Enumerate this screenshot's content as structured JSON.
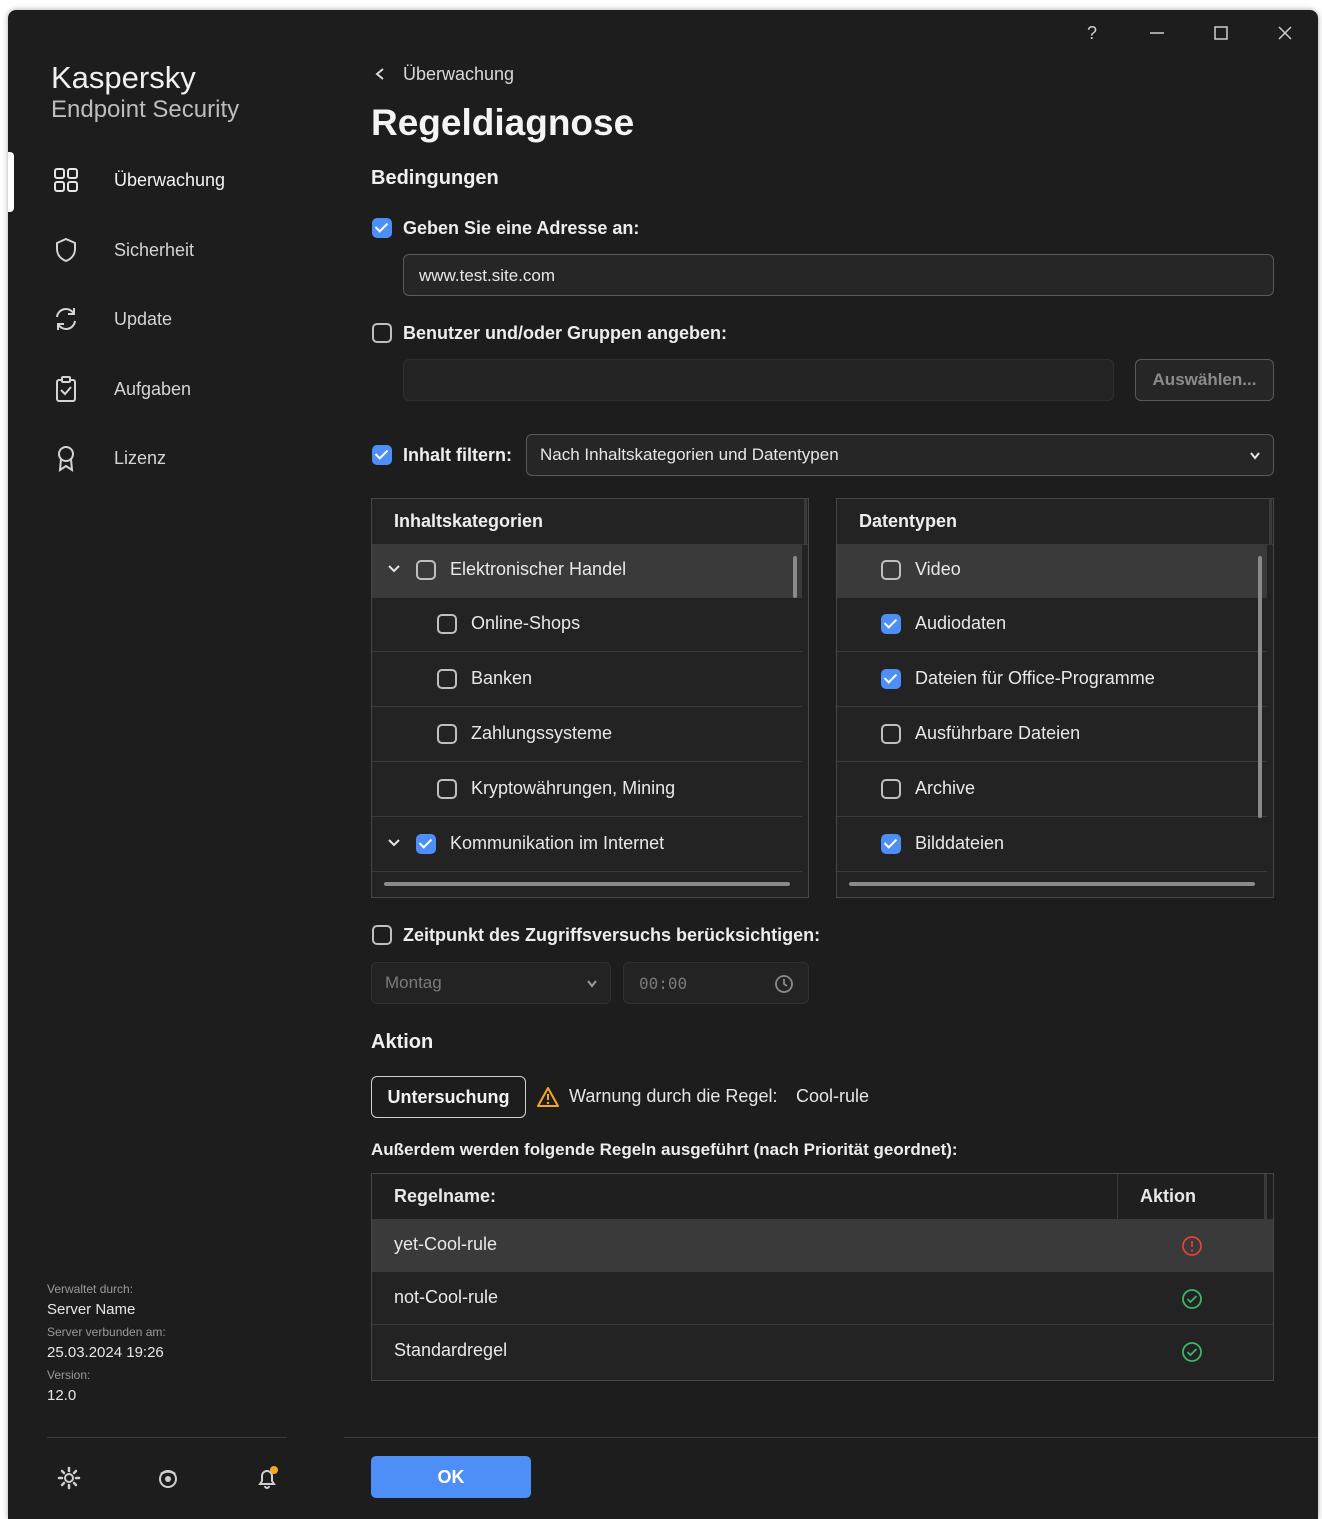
{
  "window": {
    "help_glyph": "?",
    "minimize_glyph": "—",
    "maximize_glyph": "☐",
    "close_glyph": "✕"
  },
  "sidebar": {
    "brand_name": "Kaspersky",
    "brand_product": "Endpoint Security",
    "items": [
      {
        "label": "Überwachung",
        "icon": "monitoring-grid-icon",
        "active": true
      },
      {
        "label": "Sicherheit",
        "icon": "shield-icon",
        "active": false
      },
      {
        "label": "Update",
        "icon": "refresh-icon",
        "active": false
      },
      {
        "label": "Aufgaben",
        "icon": "clipboard-check-icon",
        "active": false
      },
      {
        "label": "Lizenz",
        "icon": "award-icon",
        "active": false
      }
    ],
    "managed_by_label": "Verwaltet durch:",
    "managed_by_value": "Server Name",
    "connected_label": "Server verbunden am:",
    "connected_value": "25.03.2024 19:26",
    "version_label": "Version:",
    "version_value": "12.0",
    "footer_icons": [
      "settings-icon",
      "support-icon",
      "notifications-icon"
    ]
  },
  "main": {
    "breadcrumb": "Überwachung",
    "title": "Regeldiagnose",
    "conditions_heading": "Bedingungen",
    "address": {
      "checked": true,
      "label": "Geben Sie eine Adresse an:",
      "value": "www.test.site.com"
    },
    "users": {
      "checked": false,
      "label": "Benutzer und/oder Gruppen angeben:",
      "value": "",
      "select_button": "Auswählen..."
    },
    "content_filter": {
      "checked": true,
      "label": "Inhalt filtern:",
      "selected": "Nach Inhaltskategorien und Datentypen"
    },
    "categories": {
      "header": "Inhaltskategorien",
      "rows": [
        {
          "label": "Elektronischer Handel",
          "checked": false,
          "level": 0,
          "expandable": true
        },
        {
          "label": "Online-Shops",
          "checked": false,
          "level": 1,
          "expandable": false
        },
        {
          "label": "Banken",
          "checked": false,
          "level": 1,
          "expandable": false
        },
        {
          "label": "Zahlungssysteme",
          "checked": false,
          "level": 1,
          "expandable": false
        },
        {
          "label": "Kryptowährungen, Mining",
          "checked": false,
          "level": 1,
          "expandable": false
        },
        {
          "label": "Kommunikation im Internet",
          "checked": true,
          "level": 0,
          "expandable": true
        }
      ]
    },
    "datatypes": {
      "header": "Datentypen",
      "rows": [
        {
          "label": "Video",
          "checked": false
        },
        {
          "label": "Audiodaten",
          "checked": true
        },
        {
          "label": "Dateien für Office-Programme",
          "checked": true
        },
        {
          "label": "Ausführbare Dateien",
          "checked": false
        },
        {
          "label": "Archive",
          "checked": false
        },
        {
          "label": "Bilddateien",
          "checked": true
        }
      ]
    },
    "time": {
      "checked": false,
      "label": "Zeitpunkt des Zugriffsversuchs berücksichtigen:",
      "day": "Montag",
      "time_value": "00:00"
    },
    "action_heading": "Aktion",
    "action_button": "Untersuchung",
    "warning_text": "Warnung durch die Regel:",
    "warning_rule": "Cool-rule",
    "also_heading": "Außerdem werden folgende Regeln ausgeführt (nach Priorität geordnet):",
    "rules_table": {
      "col_name": "Regelname:",
      "col_action": "Aktion",
      "rows": [
        {
          "name": "yet-Cool-rule",
          "status": "blocked",
          "icon": "error-circle-icon"
        },
        {
          "name": "not-Cool-rule",
          "status": "allowed",
          "icon": "check-circle-icon"
        },
        {
          "name": "Standardregel",
          "status": "allowed",
          "icon": "check-circle-icon"
        }
      ]
    },
    "ok_button": "OK"
  },
  "colors": {
    "accent": "#4e8ef7",
    "background": "#1d1d1d",
    "warning": "#f5a623",
    "error": "#e0413a",
    "success": "#3fb46b"
  }
}
